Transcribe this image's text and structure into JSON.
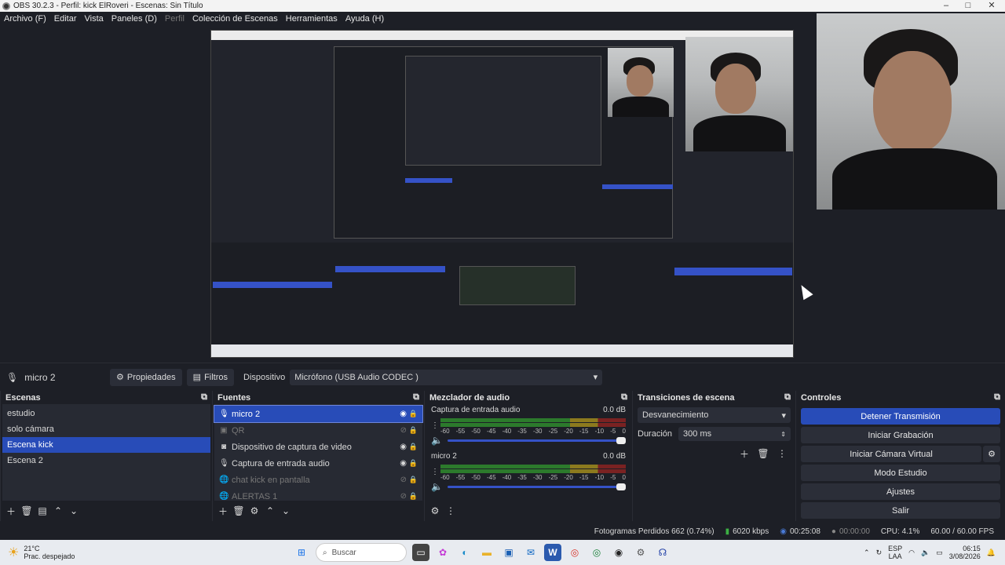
{
  "window": {
    "title": "OBS 30.2.3 - Perfil: kick ElRoveri - Escenas: Sin Título"
  },
  "menu": [
    "Archivo (F)",
    "Editar",
    "Vista",
    "Paneles (D)",
    "Perfil",
    "Colección de Escenas",
    "Herramientas",
    "Ayuda (H)"
  ],
  "source_toolbar": {
    "source_name": "micro 2",
    "properties_label": "Propiedades",
    "filters_label": "Filtros",
    "device_label": "Dispositivo",
    "device_value": "Micrófono (USB Audio CODEC )"
  },
  "scenes": {
    "title": "Escenas",
    "items": [
      "estudio",
      "solo cámara",
      "Escena kick",
      "Escena 2"
    ],
    "selected": 2
  },
  "sources": {
    "title": "Fuentes",
    "items": [
      {
        "label": "micro 2",
        "icon": "mic-icon",
        "visible": true,
        "selected": true
      },
      {
        "label": "QR",
        "icon": "image-icon",
        "visible": false,
        "selected": false
      },
      {
        "label": "Dispositivo de captura de video",
        "icon": "camera-icon",
        "visible": true,
        "selected": false
      },
      {
        "label": "Captura de entrada audio",
        "icon": "mic-icon",
        "visible": true,
        "selected": false
      },
      {
        "label": "chat kick en pantalla",
        "icon": "browser-icon",
        "visible": false,
        "selected": false
      },
      {
        "label": "ALERTAS 1",
        "icon": "browser-icon",
        "visible": false,
        "selected": false
      }
    ]
  },
  "mixer": {
    "title": "Mezclador de audio",
    "channels": [
      {
        "name": "Captura de entrada audio",
        "db": "0.0 dB"
      },
      {
        "name": "micro 2",
        "db": "0.0 dB"
      }
    ],
    "ticks": [
      "-60",
      "-55",
      "-50",
      "-45",
      "-40",
      "-35",
      "-30",
      "-25",
      "-20",
      "-15",
      "-10",
      "-5",
      "0"
    ]
  },
  "transitions": {
    "title": "Transiciones de escena",
    "selected": "Desvanecimiento",
    "duration_label": "Duración",
    "duration_value": "300 ms"
  },
  "controls": {
    "title": "Controles",
    "buttons": [
      "Detener Transmisión",
      "Iniciar Grabación",
      "Iniciar Cámara Virtual",
      "Modo Estudio",
      "Ajustes",
      "Salir"
    ]
  },
  "status": {
    "dropped": "Fotogramas Perdidos 662 (0.74%)",
    "bitrate": "6020 kbps",
    "stream_time": "00:25:08",
    "rec_time": "00:00:00",
    "cpu": "CPU: 4.1%",
    "fps": "60.00 / 60.00 FPS"
  },
  "taskbar": {
    "weather_temp": "21°C",
    "weather_desc": "Prac. despejado",
    "search_placeholder": "Buscar",
    "lang_line1": "ESP",
    "lang_line2": "LAA",
    "time": "06:15",
    "date": "3/08/2026"
  },
  "colors": {
    "accent": "#284cb8",
    "background": "#1d1f26",
    "panel": "#272a33"
  }
}
